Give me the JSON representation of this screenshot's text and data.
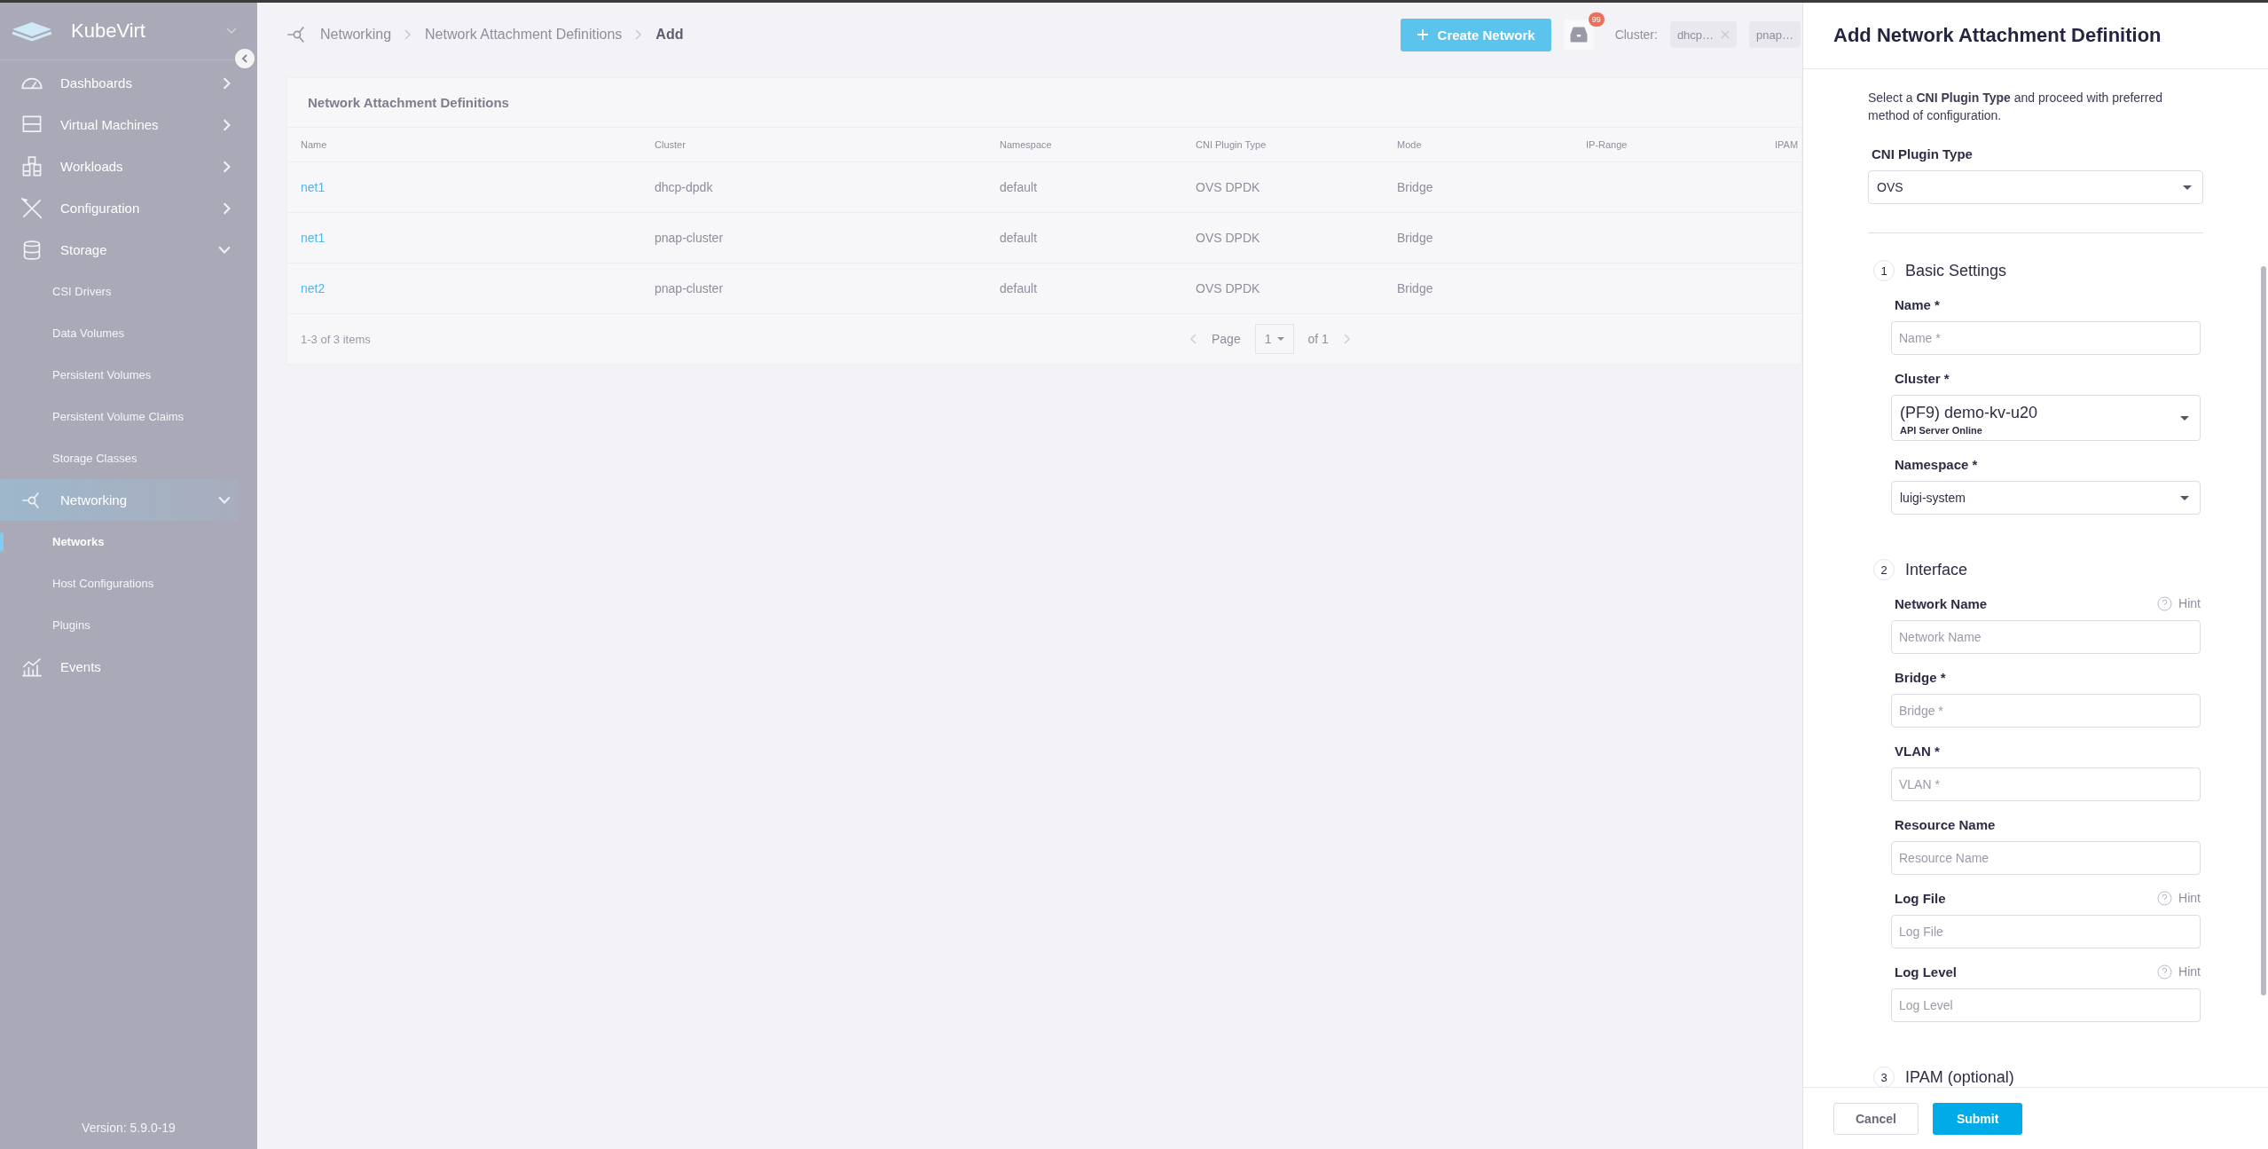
{
  "sidebar": {
    "brand": "KubeVirt",
    "items": [
      {
        "label": "Dashboards",
        "expanded": false,
        "selected": false
      },
      {
        "label": "Virtual Machines",
        "expanded": false,
        "selected": false
      },
      {
        "label": "Workloads",
        "expanded": false,
        "selected": false
      },
      {
        "label": "Configuration",
        "expanded": false,
        "selected": false
      },
      {
        "label": "Storage",
        "expanded": true,
        "selected": false,
        "children": [
          {
            "label": "CSI Drivers",
            "selected": false
          },
          {
            "label": "Data Volumes",
            "selected": false
          },
          {
            "label": "Persistent Volumes",
            "selected": false
          },
          {
            "label": "Persistent Volume Claims",
            "selected": false
          },
          {
            "label": "Storage Classes",
            "selected": false
          }
        ]
      },
      {
        "label": "Networking",
        "expanded": true,
        "selected": true,
        "children": [
          {
            "label": "Networks",
            "selected": true
          },
          {
            "label": "Host Configurations",
            "selected": false
          },
          {
            "label": "Plugins",
            "selected": false
          }
        ]
      },
      {
        "label": "Events",
        "selected": false
      }
    ],
    "version": "Version: 5.9.0-19"
  },
  "breadcrumb": [
    {
      "label": "Networking",
      "current": false
    },
    {
      "label": "Network Attachment Definitions",
      "current": false
    },
    {
      "label": "Add",
      "current": true
    }
  ],
  "toolbar": {
    "create_button": "Create Network",
    "notification_count": "99",
    "cluster_label": "Cluster:",
    "chips": [
      {
        "label": "dhcp…",
        "removable": true
      },
      {
        "label": "pnap…",
        "removable": false
      }
    ]
  },
  "table": {
    "title": "Network Attachment Definitions",
    "columns": [
      "Name",
      "Cluster",
      "Namespace",
      "CNI Plugin Type",
      "Mode",
      "IP-Range",
      "IPAM"
    ],
    "rows": [
      {
        "name": "net1",
        "cluster": "dhcp-dpdk",
        "namespace": "default",
        "cni_plugin_type": "OVS DPDK",
        "mode": "Bridge"
      },
      {
        "name": "net1",
        "cluster": "pnap-cluster",
        "namespace": "default",
        "cni_plugin_type": "OVS DPDK",
        "mode": "Bridge"
      },
      {
        "name": "net2",
        "cluster": "pnap-cluster",
        "namespace": "default",
        "cni_plugin_type": "OVS DPDK",
        "mode": "Bridge"
      }
    ],
    "item_count": "1-3 of 3 items",
    "pagination": {
      "page_label": "Page",
      "page": "1",
      "of_label": "of 1"
    }
  },
  "drawer": {
    "title": "Add Network Attachment Definition",
    "description": "Select a **CNI Plugin Type** and proceed with preferred method of configuration.",
    "plugin_field": {
      "label": "CNI Plugin Type",
      "value": "OVS"
    },
    "sections": [
      {
        "number": "1",
        "title": "Basic Settings",
        "fields": [
          {
            "kind": "input",
            "label": "Name *",
            "placeholder": "Name *"
          },
          {
            "kind": "select",
            "label": "Cluster *",
            "value": "(PF9) demo-kv-u20",
            "sublabel": "API Server Online"
          },
          {
            "kind": "select",
            "label": "Namespace *",
            "value": "luigi-system"
          }
        ]
      },
      {
        "number": "2",
        "title": "Interface",
        "fields": [
          {
            "kind": "input",
            "label": "Network Name",
            "placeholder": "Network Name",
            "hint": "Hint"
          },
          {
            "kind": "input",
            "label": "Bridge *",
            "placeholder": "Bridge *"
          },
          {
            "kind": "input",
            "label": "VLAN *",
            "placeholder": "VLAN *"
          },
          {
            "kind": "input",
            "label": "Resource Name",
            "placeholder": "Resource Name"
          },
          {
            "kind": "input",
            "label": "Log File",
            "placeholder": "Log File",
            "hint": "Hint"
          },
          {
            "kind": "input",
            "label": "Log Level",
            "placeholder": "Log Level",
            "hint": "Hint"
          }
        ]
      },
      {
        "number": "3",
        "title": "IPAM (optional)"
      }
    ],
    "buttons": [
      {
        "label": "Cancel",
        "kind": "secondary"
      },
      {
        "label": "Submit",
        "kind": "primary"
      }
    ]
  }
}
